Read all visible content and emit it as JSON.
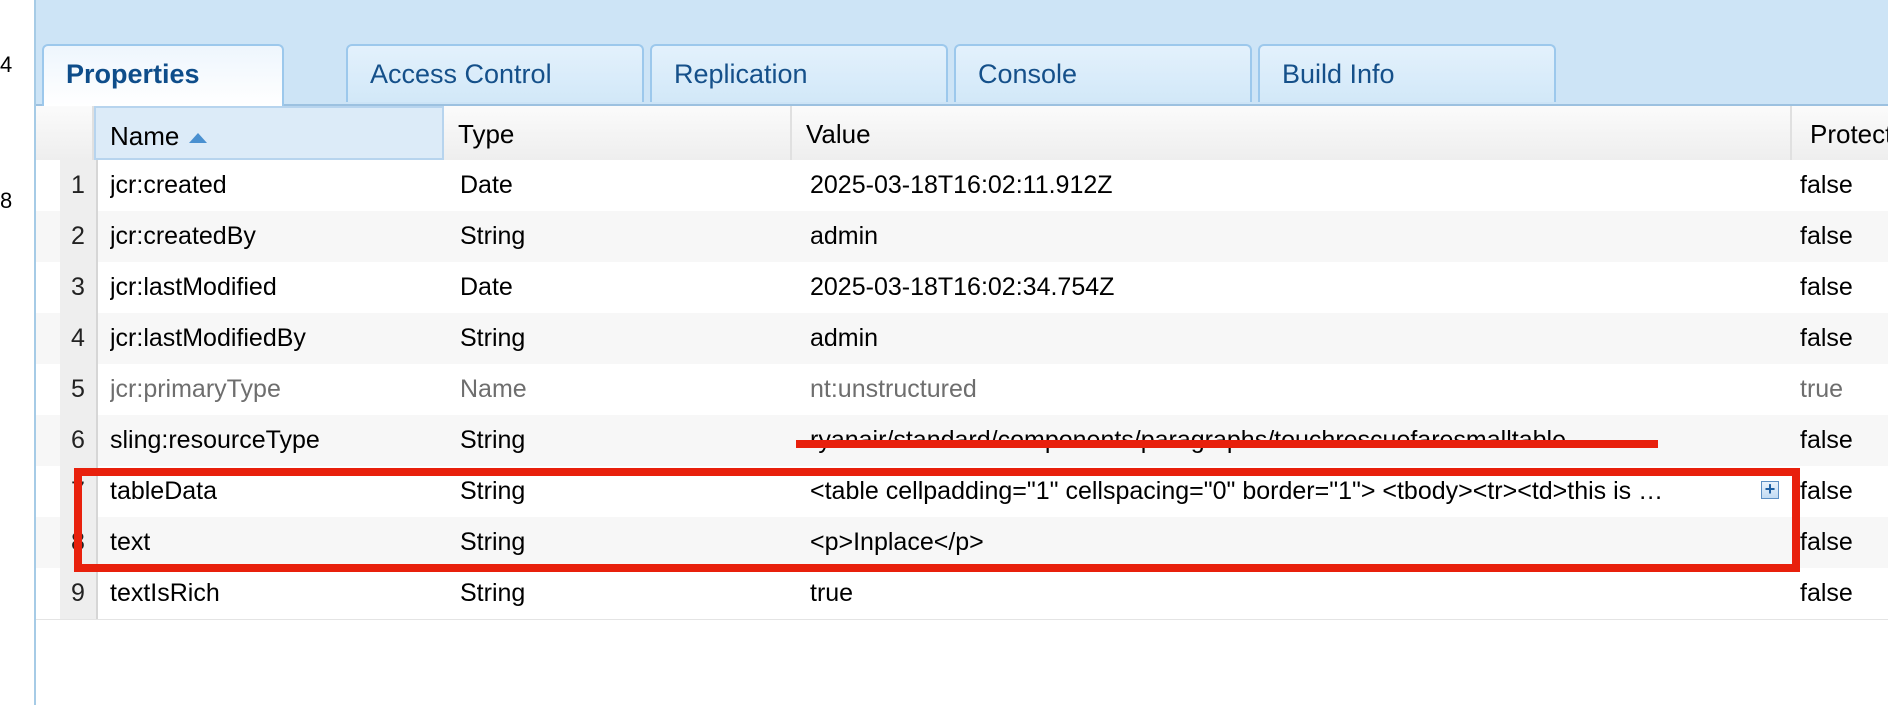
{
  "gutter": {
    "num_a": "4",
    "num_b": "8"
  },
  "tabs": [
    {
      "label": "Properties",
      "active": true
    },
    {
      "label": "Access Control"
    },
    {
      "label": "Replication"
    },
    {
      "label": "Console"
    },
    {
      "label": "Build Info"
    }
  ],
  "table": {
    "columns": {
      "name": "Name",
      "type": "Type",
      "value": "Value",
      "protected": "Protect"
    },
    "rows": [
      {
        "num": "1",
        "name": "jcr:created",
        "type": "Date",
        "value": "2025-03-18T16:02:11.912Z",
        "protected": "false"
      },
      {
        "num": "2",
        "name": "jcr:createdBy",
        "type": "String",
        "value": "admin",
        "protected": "false"
      },
      {
        "num": "3",
        "name": "jcr:lastModified",
        "type": "Date",
        "value": "2025-03-18T16:02:34.754Z",
        "protected": "false"
      },
      {
        "num": "4",
        "name": "jcr:lastModifiedBy",
        "type": "String",
        "value": "admin",
        "protected": "false"
      },
      {
        "num": "5",
        "name": "jcr:primaryType",
        "type": "Name",
        "value": "nt:unstructured",
        "protected": "true"
      },
      {
        "num": "6",
        "name": "sling:resourceType",
        "type": "String",
        "value": "ryanair/standard/components/paragraphs/touchrescuefaresmalltable",
        "protected": "false"
      },
      {
        "num": "7",
        "name": "tableData",
        "type": "String",
        "value": "<table cellpadding=\"1\" cellspacing=\"0\" border=\"1\"> <tbody><tr><td>this is …",
        "protected": "false"
      },
      {
        "num": "8",
        "name": "text",
        "type": "String",
        "value": "<p>Inplace</p>",
        "protected": "false"
      },
      {
        "num": "9",
        "name": "textIsRich",
        "type": "String",
        "value": "true",
        "protected": "false"
      }
    ]
  },
  "colors": {
    "annotation_red": "#e8200c",
    "tab_blue": "#cde4f6"
  },
  "icons": {
    "sort": "sort-ascending-icon",
    "expand": "expand-plus-icon"
  }
}
